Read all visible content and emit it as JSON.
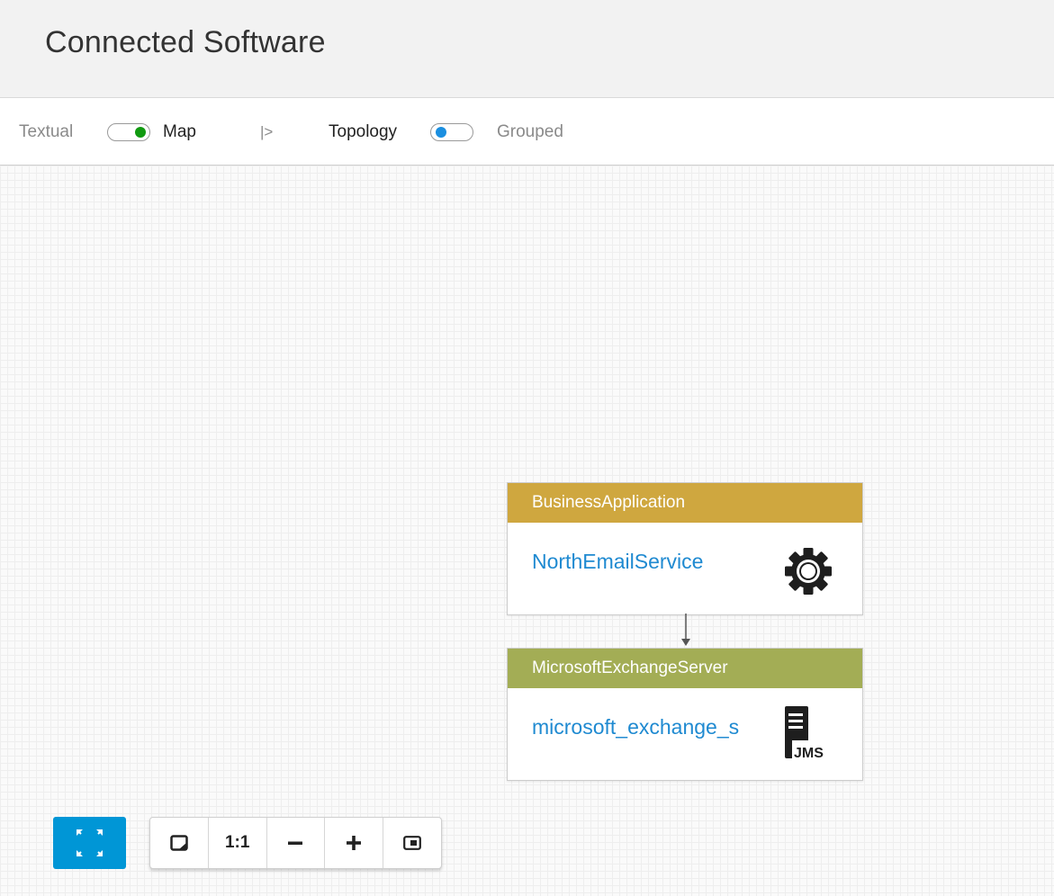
{
  "header": {
    "title": "Connected Software"
  },
  "toolbar": {
    "textual_label": "Textual",
    "map_label": "Map",
    "separator": "|>",
    "topology_label": "Topology",
    "grouped_label": "Grouped",
    "view_toggle_state": "Map",
    "layout_toggle_state": "Topology",
    "view_toggle_color": "#119a11",
    "layout_toggle_color": "#1b8fe0"
  },
  "nodes": [
    {
      "type": "BusinessApplication",
      "name": "NorthEmailService",
      "header_color": "#cfa73f",
      "icon": "gear-icon"
    },
    {
      "type": "MicrosoftExchangeServer",
      "name": "microsoft_exchange_s",
      "header_color": "#a3ad55",
      "icon": "jms-server-icon",
      "icon_text": "JMS"
    }
  ],
  "controls": {
    "fit": "fit-to-screen-icon",
    "one_to_one": "1:1",
    "zoom_out": "−",
    "zoom_in": "+",
    "overview": "overview-icon"
  }
}
